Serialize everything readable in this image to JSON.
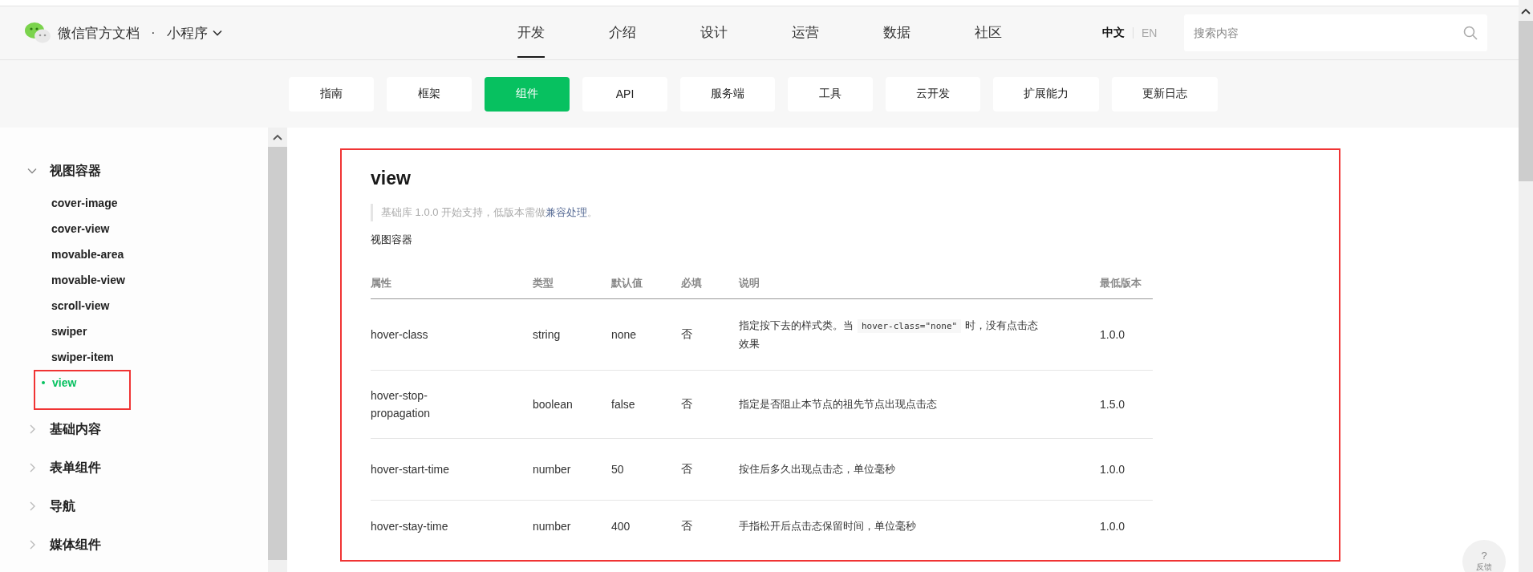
{
  "header": {
    "site_title": "微信官方文档",
    "separator": "·",
    "product": "小程序",
    "nav": [
      {
        "label": "开发",
        "selected": true
      },
      {
        "label": "介绍",
        "selected": false
      },
      {
        "label": "设计",
        "selected": false
      },
      {
        "label": "运营",
        "selected": false
      },
      {
        "label": "数据",
        "selected": false
      },
      {
        "label": "社区",
        "selected": false
      }
    ],
    "languages": [
      {
        "label": "中文",
        "selected": true
      },
      {
        "label": "EN",
        "selected": false
      }
    ],
    "search": {
      "placeholder": "搜索内容"
    }
  },
  "subnav": [
    {
      "label": "指南",
      "selected": false
    },
    {
      "label": "框架",
      "selected": false
    },
    {
      "label": "组件",
      "selected": true
    },
    {
      "label": "API",
      "selected": false
    },
    {
      "label": "服务端",
      "selected": false
    },
    {
      "label": "工具",
      "selected": false
    },
    {
      "label": "云开发",
      "selected": false
    },
    {
      "label": "扩展能力",
      "selected": false
    },
    {
      "label": "更新日志",
      "selected": false
    }
  ],
  "sidebar": {
    "groups": [
      {
        "label": "视图容器",
        "expanded": true,
        "children": [
          {
            "label": "cover-image",
            "selected": false,
            "highlighted": false
          },
          {
            "label": "cover-view",
            "selected": false,
            "highlighted": false
          },
          {
            "label": "movable-area",
            "selected": false,
            "highlighted": false
          },
          {
            "label": "movable-view",
            "selected": false,
            "highlighted": false
          },
          {
            "label": "scroll-view",
            "selected": false,
            "highlighted": false
          },
          {
            "label": "swiper",
            "selected": false,
            "highlighted": false
          },
          {
            "label": "swiper-item",
            "selected": false,
            "highlighted": false
          },
          {
            "label": "view",
            "selected": true,
            "highlighted": true
          }
        ]
      },
      {
        "label": "基础内容",
        "expanded": false
      },
      {
        "label": "表单组件",
        "expanded": false
      },
      {
        "label": "导航",
        "expanded": false
      },
      {
        "label": "媒体组件",
        "expanded": false
      }
    ]
  },
  "content": {
    "highlighted": true,
    "title": "view",
    "note": {
      "text": "基础库 1.0.0 开始支持，低版本需做",
      "link": "兼容处理",
      "end": "。"
    },
    "description": "视图容器",
    "table": {
      "columns": [
        "属性",
        "类型",
        "默认值",
        "必填",
        "说明",
        "最低版本"
      ],
      "rows": [
        {
          "attribute": "hover-class",
          "type": "string",
          "default": "none",
          "required": "否",
          "description": [
            {
              "kind": "text",
              "text": "指定按下去的样式类。当"
            },
            {
              "kind": "code",
              "text": "hover-class=\"none\""
            },
            {
              "kind": "text",
              "text": "时，没有点击态效果"
            }
          ],
          "version": "1.0.0"
        },
        {
          "attribute": "hover-stop-propagation",
          "type": "boolean",
          "default": "false",
          "required": "否",
          "description": [
            {
              "kind": "text",
              "text": "指定是否阻止本节点的祖先节点出现点击态"
            }
          ],
          "version": "1.5.0"
        },
        {
          "attribute": "hover-start-time",
          "type": "number",
          "default": "50",
          "required": "否",
          "description": [
            {
              "kind": "text",
              "text": "按住后多久出现点击态，单位毫秒"
            }
          ],
          "version": "1.0.0"
        },
        {
          "attribute": "hover-stay-time",
          "type": "number",
          "default": "400",
          "required": "否",
          "description": [
            {
              "kind": "text",
              "text": "手指松开后点击态保留时间，单位毫秒"
            }
          ],
          "version": "1.0.0"
        }
      ]
    }
  },
  "feedback": {
    "icon": "?",
    "label": "反馈"
  }
}
